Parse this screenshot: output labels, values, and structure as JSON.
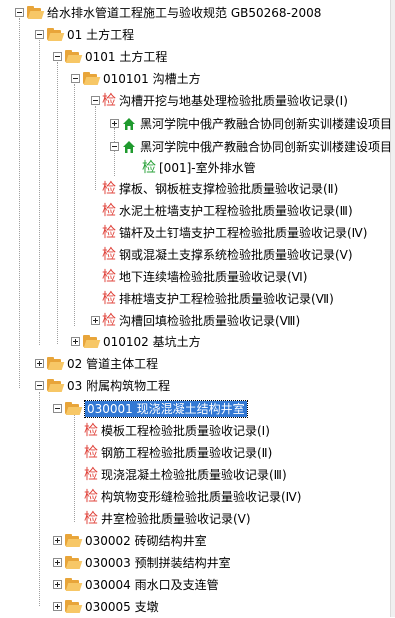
{
  "tree": {
    "root": {
      "label": "给水排水管道工程施工与验收规范 GB50268-2008"
    },
    "n01": {
      "label": "01 土方工程"
    },
    "n0101": {
      "label": "0101 土方工程"
    },
    "n010101": {
      "label": "010101 沟槽土方"
    },
    "n_trench": {
      "label": "沟槽开挖与地基处理检验批质量验收记录(Ⅰ)"
    },
    "n_heihe1": {
      "label": "黑河学院中俄产教融合协同创新实训楼建设项目"
    },
    "n_heihe2": {
      "label": "黑河学院中俄产教融合协同创新实训楼建设项目"
    },
    "n_outdoor": {
      "label": "[001]-室外排水管"
    },
    "n_shoring": {
      "label": "撑板、钢板桩支撑检验批质量验收记录(Ⅱ)"
    },
    "n_cement": {
      "label": "水泥土桩墙支护工程检验批质量验收记录(Ⅲ)"
    },
    "n_anchor": {
      "label": "锚杆及土钉墙支护工程检验批质量验收记录(Ⅳ)"
    },
    "n_steel": {
      "label": "钢或混凝土支撑系统检验批质量验收记录(Ⅴ)"
    },
    "n_diaphragm": {
      "label": "地下连续墙检验批质量验收记录(Ⅵ)"
    },
    "n_pile": {
      "label": "排桩墙支护工程检验批质量验收记录(Ⅶ)"
    },
    "n_backfill": {
      "label": "沟槽回填检验批质量验收记录(Ⅷ)"
    },
    "n010102": {
      "label": "010102 基坑土方"
    },
    "n02": {
      "label": "02 管道主体工程"
    },
    "n03": {
      "label": "03 附属构筑物工程"
    },
    "n030001": {
      "label": "030001 现浇混凝土结构井室"
    },
    "n_formwork": {
      "label": "模板工程检验批质量验收记录(Ⅰ)"
    },
    "n_rebar": {
      "label": "钢筋工程检验批质量验收记录(Ⅱ)"
    },
    "n_concrete": {
      "label": "现浇混凝土检验批质量验收记录(Ⅲ)"
    },
    "n_joint": {
      "label": "构筑物变形缝检验批质量验收记录(Ⅳ)"
    },
    "n_well": {
      "label": "井室检验批质量验收记录(Ⅴ)"
    },
    "n030002": {
      "label": "030002 砖砌结构井室"
    },
    "n030003": {
      "label": "030003 预制拼装结构井室"
    },
    "n030004": {
      "label": "030004 雨水口及支连管"
    },
    "n030005": {
      "label": "030005 支墩"
    }
  },
  "icons": {
    "folder": "folder-icon",
    "inspection": "inspection-lot-icon",
    "project": "house-icon"
  },
  "colors": {
    "folder": "#e8a53a",
    "inspection_red": "#e0443c",
    "inspection_green": "#2aa23a",
    "selection": "#3278d3",
    "house": "#1f9a2e"
  },
  "selection": "030001 现浇混凝土结构井室",
  "check_glyph": "检"
}
